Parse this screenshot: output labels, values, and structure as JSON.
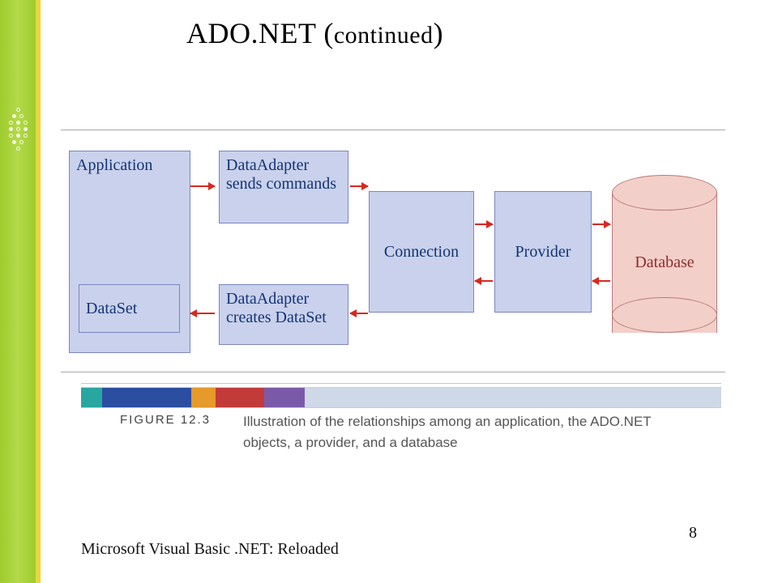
{
  "title": {
    "main": "ADO.NET (",
    "sub": "continued",
    "end": ")"
  },
  "diagram": {
    "application": "Application",
    "dataset": "DataSet",
    "dataAdapterSend": "DataAdapter sends commands",
    "dataAdapterCreate": "DataAdapter creates DataSet",
    "connection": "Connection",
    "provider": "Provider",
    "database": "Database"
  },
  "figure": {
    "label": "FIGURE 12.3",
    "caption": "Illustration of the relationships among an application, the ADO.NET objects, a provider, and a database"
  },
  "footer": {
    "left": "Microsoft Visual Basic .NET: Reloaded",
    "page": "8"
  }
}
